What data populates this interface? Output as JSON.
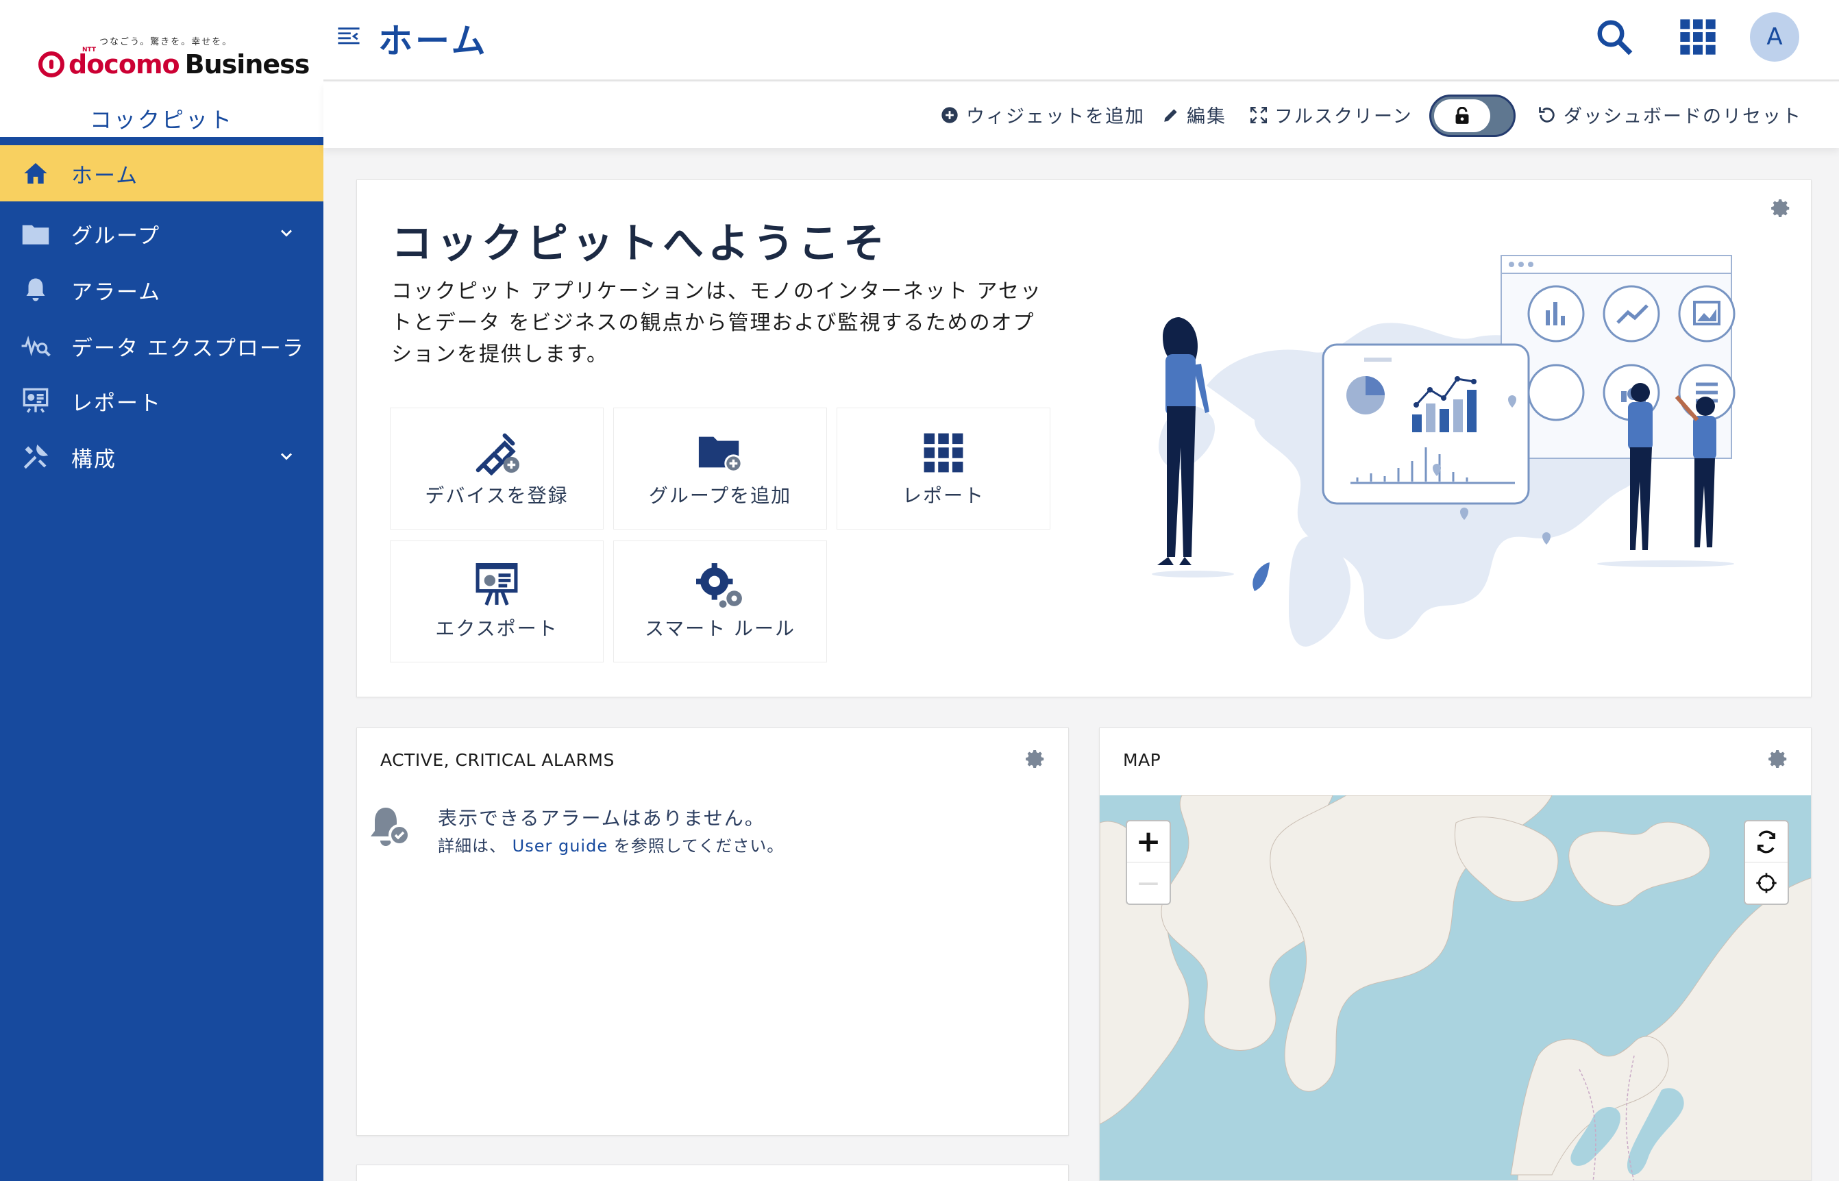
{
  "brand": {
    "tagline": "つなごう。驚きを。幸せを。",
    "ntt": "NTT",
    "name_docomo": "docomo",
    "name_business": "Business",
    "app_name": "コックピット"
  },
  "sidebar": {
    "items": [
      {
        "label": "ホーム",
        "icon": "home-icon",
        "active": true
      },
      {
        "label": "グループ",
        "icon": "folder-icon",
        "expandable": true
      },
      {
        "label": "アラーム",
        "icon": "bell-icon"
      },
      {
        "label": "データ エクスプローラ",
        "icon": "data-explorer-icon"
      },
      {
        "label": "レポート",
        "icon": "report-icon"
      },
      {
        "label": "構成",
        "icon": "configuration-icon",
        "expandable": true
      }
    ]
  },
  "header": {
    "title": "ホーム",
    "avatar_initial": "A"
  },
  "actions": {
    "add_widget": "ウィジェットを追加",
    "edit": "編集",
    "fullscreen": "フルスクリーン",
    "reset": "ダッシュボードのリセット"
  },
  "welcome": {
    "title": "コックピットへようこそ",
    "description": "コックピット アプリケーションは、モノのインターネット アセットとデータ をビジネスの観点から管理および監視するためのオプションを提供します。",
    "tiles": [
      {
        "label": "デバイスを登録",
        "icon": "plug-add-icon"
      },
      {
        "label": "グループを追加",
        "icon": "folder-add-icon"
      },
      {
        "label": "レポート",
        "icon": "grid-icon"
      },
      {
        "label": "エクスポート",
        "icon": "presentation-icon"
      },
      {
        "label": "スマート ルール",
        "icon": "gears-icon"
      }
    ]
  },
  "alarms_widget": {
    "title": "ACTIVE, CRITICAL ALARMS",
    "empty_message": "表示できるアラームはありません。",
    "hint_prefix": "詳細は、",
    "hint_link": "User guide",
    "hint_suffix": "を参照してください。"
  },
  "map_widget": {
    "title": "MAP",
    "zoom_in": "+",
    "zoom_out": "−"
  },
  "colors": {
    "primary": "#174a9e",
    "active_nav": "#f8d060",
    "brand_red": "#cc0033",
    "map_water": "#aad3df",
    "map_land": "#f2efe9"
  }
}
